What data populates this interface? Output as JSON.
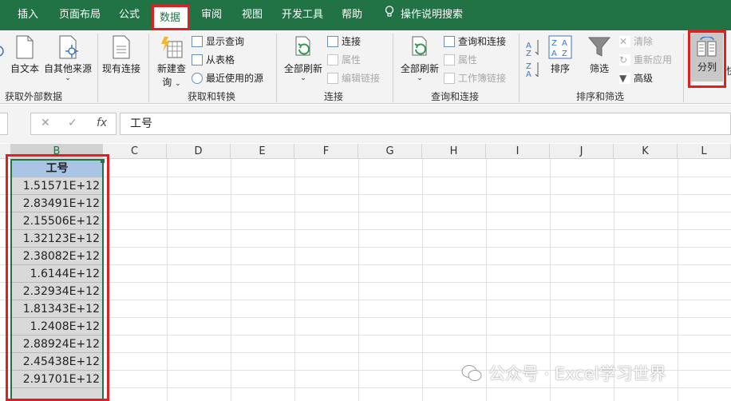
{
  "tabs": [
    {
      "label": "插入",
      "active": false
    },
    {
      "label": "页面布局",
      "active": false
    },
    {
      "label": "公式",
      "active": false
    },
    {
      "label": "数据",
      "active": true
    },
    {
      "label": "审阅",
      "active": false
    },
    {
      "label": "视图",
      "active": false
    },
    {
      "label": "开发工具",
      "active": false
    },
    {
      "label": "帮助",
      "active": false
    },
    {
      "label": "操作说明搜索",
      "active": false
    }
  ],
  "ribbon": {
    "groups": {
      "external": "获取外部数据",
      "transform": "获取和转换",
      "connections": "连接",
      "query": "查询和连接",
      "sort": "排序和筛选"
    },
    "external": {
      "from_text": "自文本",
      "from_other": "自其他来源",
      "existing": "现有连接"
    },
    "transform": {
      "new_query_1": "新建查",
      "new_query_2": "询",
      "show_query": "显示查询",
      "from_table": "从表格",
      "recent": "最近使用的源"
    },
    "connections": {
      "refresh_all": "全部刷新",
      "connect": "连接",
      "properties": "属性",
      "edit_links": "编辑链接"
    },
    "query": {
      "refresh_all": "全部刷新",
      "query_connect": "查询和连接",
      "properties": "属性",
      "workbook_links": "工作簿链接"
    },
    "sort": {
      "sort": "排序",
      "filter": "筛选",
      "clear": "清除",
      "reapply": "重新应用",
      "advanced": "高级"
    },
    "split": "分列"
  },
  "formula_bar": {
    "value": "工号"
  },
  "columns": [
    "B",
    "C",
    "D",
    "E",
    "F",
    "G",
    "H",
    "I",
    "J",
    "K",
    "L"
  ],
  "column_b": {
    "header": "工号",
    "values": [
      "1.51571E+12",
      "2.83491E+12",
      "2.15506E+12",
      "1.32123E+12",
      "2.38082E+12",
      "1.6144E+12",
      "2.32934E+12",
      "1.81343E+12",
      "1.2408E+12",
      "2.88924E+12",
      "2.45438E+12",
      "2.91701E+12"
    ]
  },
  "watermark": "公众号 · Excel学习世界",
  "colors": {
    "ribbon_green": "#217346",
    "highlight_red": "#e02020",
    "header_cell": "#a9c4e4",
    "selected_cell": "#d9d9d9"
  }
}
